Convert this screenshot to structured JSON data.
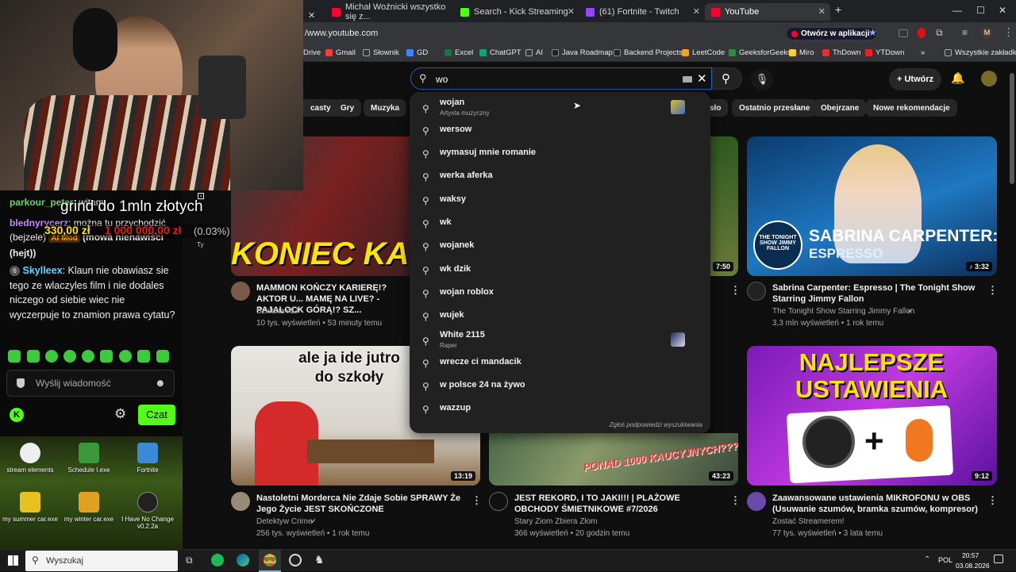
{
  "browser": {
    "tabs": [
      {
        "label": "Michał Woźnicki wszystko się z...",
        "color": "#ff0033"
      },
      {
        "label": "Search - Kick Streaming",
        "color": "#53fc18"
      },
      {
        "label": "(61) Fortnite - Twitch",
        "color": "#9146ff"
      },
      {
        "label": "YouTube",
        "color": "#ff0033"
      }
    ],
    "url": "/www.youtube.com",
    "open_in_app": "Otwórz w aplikacji",
    "bookmarks": [
      "Drive",
      "Gmail",
      "Słownik",
      "GD",
      "Excel",
      "ChatGPT",
      "AI",
      "Java Roadmap",
      "Backend Projects",
      "LeetCode",
      "GeeksforGeeks",
      "Miro",
      "ThDown",
      "YTDown"
    ],
    "all_bookmarks": "Wszystkie zakładki"
  },
  "youtube": {
    "search_value": "wo",
    "create_label": "Utwórz",
    "chips": [
      "casty",
      "Gry",
      "Muzyka",
      "sło",
      "Ostatnio przesłane",
      "Obejrzane",
      "Nowe rekomendacje"
    ],
    "suggestions": [
      {
        "text": "wojan",
        "sub": "Artysta muzyczny"
      },
      {
        "text": "wersow"
      },
      {
        "text": "wymasuj mnie romanie"
      },
      {
        "text": "werka aferka"
      },
      {
        "text": "waksy"
      },
      {
        "text": "wk"
      },
      {
        "text": "wojanek"
      },
      {
        "text": "wk dzik"
      },
      {
        "text": "wojan roblox"
      },
      {
        "text": "wujek"
      },
      {
        "text": "White 2115",
        "sub": "Raper"
      },
      {
        "text": "wrecze ci mandacik"
      },
      {
        "text": "w polsce 24 na żywo"
      },
      {
        "text": "wazzup"
      }
    ],
    "report_suggestions": "Zgłoś podpowiedzi wyszukiwania",
    "videos": [
      {
        "title": "MAMMON KOŃCZY KARIERĘ!? AKTOR U... MAMĘ NA LIVE? - PAJALOCK GÓRĄ!? SZ...",
        "channel": "SzklanaY2J",
        "meta": "10 tys. wyświetleń • 53 minuty temu",
        "thumb_text": "KONIEC KARI"
      },
      {
        "title": "Sabrina Carpenter: Espresso | The Tonight Show Starring Jimmy Fallon",
        "channel": "The Tonight Show Starring Jimmy Fallon",
        "meta": "3,3 mln wyświetleń • 1 rok temu",
        "duration": "3:32",
        "thumb_text": "SABRINA CARPENTER:",
        "thumb_sub": "ESPRESSO",
        "thumb_logo": "THE TONIGHT SHOW JIMMY FALLON"
      },
      {
        "title": "Nastoletni Morderca Nie Zdaje Sobie SPRAWY Że Jego Życie JEST SKOŃCZONE",
        "channel": "Detektyw Crime",
        "meta": "256 tys. wyświetleń • 1 rok temu",
        "duration": "13:19",
        "thumb_text": "ale ja ide jutro do szkoły"
      },
      {
        "title": "JEST REKORD, I TO JAKI!!! | PLAŻOWE OBCHODY ŚMIETNIKOWE #7/2026",
        "channel": "Stary Ziom Zbiera Złom",
        "meta": "366 wyświetleń • 20 godzin temu",
        "duration": "43:23",
        "thumb_text": "PONAD 1000 KAUCYJNYCH???"
      },
      {
        "title": "Zaawansowane ustawienia MIKROFONU w OBS (Usuwanie szumów, bramka szumów, kompresor)",
        "channel": "Zostać Streamerem!",
        "meta": "77 tys. wyświetleń • 3 lata temu",
        "duration": "9:12",
        "thumb_text": "NAJLEPSZE USTAWIENIA"
      },
      {
        "duration": "7:50"
      }
    ]
  },
  "stream": {
    "goal_text": "grind do 1mln złotych",
    "goal_current": "330,00 zł",
    "goal_target": "1 000 000,00 zł",
    "goal_percent": "(0.03%)",
    "chat": [
      {
        "user": "parkour_peter",
        "text": ": witam",
        "color": "#6bd26b"
      },
      {
        "user": "blednyrycerz",
        "text": ": można tu przychodzić (bejzele) ",
        "badge": "AI Mod",
        "tail": "(mowa nienawiści (hejt))",
        "color": "#c58af9"
      },
      {
        "user": "Skylleex",
        "text": ": Klaun nie obawiasz sie tego ze wlaczyles film i nie dodales niczego od siebie wiec nie wyczerpuje to znamion prawa cytatu?",
        "color": "#6bd2ff"
      }
    ],
    "chat_placeholder": "Wyślij wiadomość",
    "chat_button": "Czat",
    "ty_label": "Ty"
  },
  "desktop": {
    "icons": [
      "stream elements",
      "Schedule I.exe",
      "Fortnite",
      "my summer car.exe",
      "my winter car.exe",
      "I Have No Change v0.2.2a"
    ]
  },
  "taskbar": {
    "search": "Wyszukaj",
    "lang": "POL",
    "time": "20:57",
    "date": "03.08.2026"
  }
}
